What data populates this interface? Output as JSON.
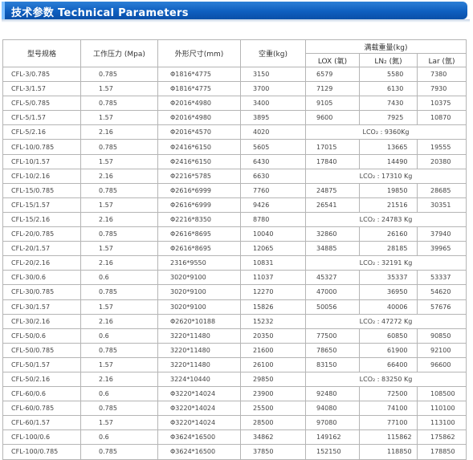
{
  "header": {
    "title": "技术参数 Technical Parameters"
  },
  "table": {
    "columns": {
      "model": "型号规格",
      "pressure": "工作压力 (Mpa)",
      "dims": "外形尺寸(mm)",
      "empty_weight": "空重(kg)",
      "full_weight": "满载重量(kg)",
      "lox": "LOX (氧)",
      "ln2": "LN₂ (氮)",
      "lar": "Lar (氩)"
    },
    "rows": [
      [
        "CFL-3/0.785",
        "0.785",
        "Φ1816*4775",
        "3150",
        "6579",
        "5580",
        "7380"
      ],
      [
        "CFL-3/1.57",
        "1.57",
        "Φ1816*4775",
        "3700",
        "7129",
        "6130",
        "7930"
      ],
      [
        "CFL-5/0.785",
        "0.785",
        "Φ2016*4980",
        "3400",
        "9105",
        "7430",
        "10375"
      ],
      [
        "CFL-5/1.57",
        "1.57",
        "Φ2016*4980",
        "3895",
        "9600",
        "7925",
        "10870"
      ],
      [
        "CFL-5/2.16",
        "2.16",
        "Φ2016*4570",
        "4020",
        "LCO₂ : 9360Kg"
      ],
      [
        "CFL-10/0.785",
        "0.785",
        "Φ2416*6150",
        "5605",
        "17015",
        "13665",
        "19555"
      ],
      [
        "CFL-10/1.57",
        "1.57",
        "Φ2416*6150",
        "6430",
        "17840",
        "14490",
        "20380"
      ],
      [
        "CFL-10/2.16",
        "2.16",
        "Φ2216*5785",
        "6630",
        "LCO₂ : 17310 Kg"
      ],
      [
        "CFL-15/0.785",
        "0.785",
        "Φ2616*6999",
        "7760",
        "24875",
        "19850",
        "28685"
      ],
      [
        "CFL-15/1.57",
        "1.57",
        "Φ2616*6999",
        "9426",
        "26541",
        "21516",
        "30351"
      ],
      [
        "CFL-15/2.16",
        "2.16",
        "Φ2216*8350",
        "8780",
        "LCO₂ : 24783 Kg"
      ],
      [
        "CFL-20/0.785",
        "0.785",
        "Φ2616*8695",
        "10040",
        "32860",
        "26160",
        "37940"
      ],
      [
        "CFL-20/1.57",
        "1.57",
        "Φ2616*8695",
        "12065",
        "34885",
        "28185",
        "39965"
      ],
      [
        "CFL-20/2.16",
        "2.16",
        "2316*9550",
        "10831",
        "LCO₂ : 32191 Kg"
      ],
      [
        "CFL-30/0.6",
        "0.6",
        "3020*9100",
        "11037",
        "45327",
        "35337",
        "53337"
      ],
      [
        "CFL-30/0.785",
        "0.785",
        "3020*9100",
        "12270",
        "47000",
        "36950",
        "54620"
      ],
      [
        "CFL-30/1.57",
        "1.57",
        "3020*9100",
        "15826",
        "50056",
        "40006",
        "57676"
      ],
      [
        "CFL-30/2.16",
        "2.16",
        "Φ2620*10188",
        "15232",
        "LCO₂ : 47272 Kg"
      ],
      [
        "CFL-50/0.6",
        "0.6",
        "3220*11480",
        "20350",
        "77500",
        "60850",
        "90850"
      ],
      [
        "CFL-50/0.785",
        "0.785",
        "3220*11480",
        "21600",
        "78650",
        "61900",
        "92100"
      ],
      [
        "CFL-50/1.57",
        "1.57",
        "3220*11480",
        "26100",
        "83150",
        "66400",
        "96600"
      ],
      [
        "CFL-50/2.16",
        "2.16",
        "3224*10440",
        "29850",
        "LCO₂ : 83250 Kg"
      ],
      [
        "CFL-60/0.6",
        "0.6",
        "Φ3220*14024",
        "23900",
        "92480",
        "72500",
        "108500"
      ],
      [
        "CFL-60/0.785",
        "0.785",
        "Φ3220*14024",
        "25500",
        "94080",
        "74100",
        "110100"
      ],
      [
        "CFL-60/1.57",
        "1.57",
        "Φ3220*14024",
        "28500",
        "97080",
        "77100",
        "113100"
      ],
      [
        "CFL-100/0.6",
        "0.6",
        "Φ3624*16500",
        "34862",
        "149162",
        "115862",
        "175862"
      ],
      [
        "CFL-100/0.785",
        "0.785",
        "Φ3624*16500",
        "37850",
        "152150",
        "118850",
        "178850"
      ]
    ]
  }
}
